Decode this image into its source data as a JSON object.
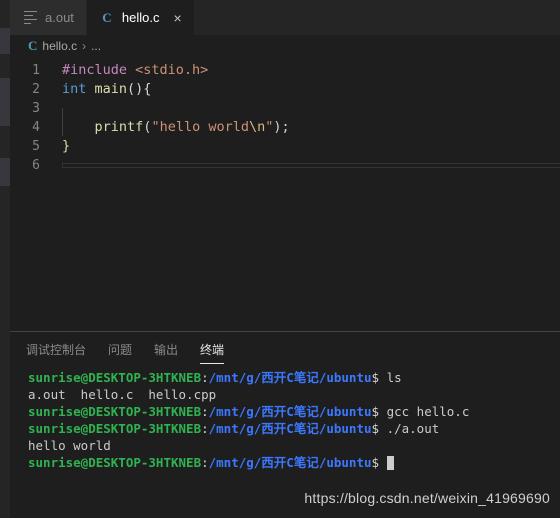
{
  "tabs": [
    {
      "label": "a.out",
      "icon": "binary-file-icon",
      "active": false,
      "closable": false
    },
    {
      "label": "hello.c",
      "icon": "c-file-icon",
      "active": true,
      "closable": true,
      "close_label": "×"
    }
  ],
  "breadcrumb": {
    "icon": "c-file-icon",
    "icon_label": "C",
    "file": "hello.c",
    "separator": "›",
    "dots": "..."
  },
  "editor": {
    "lines": [
      {
        "num": "1",
        "tokens": [
          {
            "text": "#include ",
            "type": "preproc"
          },
          {
            "text": "<stdio.h>",
            "type": "include"
          }
        ]
      },
      {
        "num": "2",
        "tokens": [
          {
            "text": "int ",
            "type": "keyword"
          },
          {
            "text": "main",
            "type": "function"
          },
          {
            "text": "(){",
            "type": "punct"
          }
        ]
      },
      {
        "num": "3",
        "tokens": []
      },
      {
        "num": "4",
        "tokens": [
          {
            "text": "    ",
            "type": "punct"
          },
          {
            "text": "printf",
            "type": "function"
          },
          {
            "text": "(",
            "type": "punct"
          },
          {
            "text": "\"hello world",
            "type": "string"
          },
          {
            "text": "\\n",
            "type": "escape"
          },
          {
            "text": "\"",
            "type": "string"
          },
          {
            "text": ");",
            "type": "punct"
          }
        ]
      },
      {
        "num": "5",
        "tokens": [
          {
            "text": "}",
            "type": "brace"
          }
        ]
      },
      {
        "num": "6",
        "tokens": []
      }
    ]
  },
  "panel": {
    "tabs": [
      {
        "label": "调试控制台",
        "active": false
      },
      {
        "label": "问题",
        "active": false
      },
      {
        "label": "输出",
        "active": false
      },
      {
        "label": "终端",
        "active": true
      }
    ],
    "terminal": {
      "prompt": {
        "user": "sunrise@DESKTOP-3HTKNEB",
        "colon": ":",
        "path": "/mnt/g/西开C笔记/ubuntu",
        "dollar": "$ "
      },
      "lines": [
        {
          "kind": "prompt",
          "command": "ls"
        },
        {
          "kind": "output",
          "text": "a.out  hello.c  hello.cpp"
        },
        {
          "kind": "prompt",
          "command": "gcc hello.c"
        },
        {
          "kind": "prompt",
          "command": "./a.out"
        },
        {
          "kind": "output",
          "text": "hello world"
        },
        {
          "kind": "prompt-cursor",
          "command": ""
        }
      ]
    }
  },
  "watermark": "https://blog.csdn.net/weixin_41969690",
  "colors": {
    "editor_bg": "#1e1e1e",
    "tabbar_bg": "#252526",
    "inactive_tab_bg": "#2d2d2d",
    "accent_blue": "#519aba",
    "terminal_green": "#2fb350",
    "terminal_blue": "#3b78ff"
  }
}
